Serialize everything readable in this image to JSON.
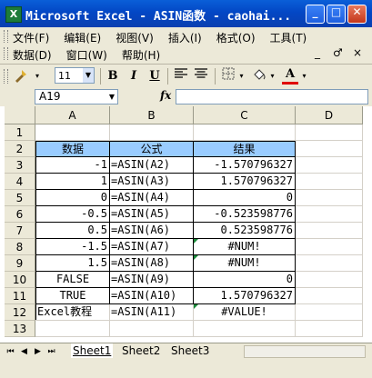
{
  "window": {
    "title": "Microsoft Excel - ASIN函数 - caohai...",
    "app_icon_letter": "X",
    "minimize_label": "_",
    "maximize_label": "□",
    "close_label": "✕"
  },
  "menu": {
    "row1": [
      "文件(F)",
      "编辑(E)",
      "视图(V)",
      "插入(I)",
      "格式(O)",
      "工具(T)"
    ],
    "row2": [
      "数据(D)",
      "窗口(W)",
      "帮助(H)"
    ],
    "doc_controls": [
      "_",
      "♂",
      "×"
    ]
  },
  "toolbar": {
    "font_size": "11",
    "bold": "B",
    "italic": "I",
    "underline": "U",
    "font_color_label": "A"
  },
  "formula_bar": {
    "name_box": "A19",
    "fx_label": "fx",
    "formula": ""
  },
  "grid": {
    "columns": [
      "A",
      "B",
      "C",
      "D"
    ],
    "rows": [
      "1",
      "2",
      "3",
      "4",
      "5",
      "6",
      "7",
      "8",
      "9",
      "10",
      "11",
      "12",
      "13"
    ],
    "header_row": {
      "A": "",
      "B": "",
      "C": "",
      "D": ""
    },
    "table": [
      {
        "row": 2,
        "a": "数据",
        "b": "公式",
        "c": "结果",
        "hdr": true
      },
      {
        "row": 3,
        "a": "-1",
        "b": "=ASIN(A2)",
        "c": "-1.570796327"
      },
      {
        "row": 4,
        "a": "1",
        "b": "=ASIN(A3)",
        "c": "1.570796327"
      },
      {
        "row": 5,
        "a": "0",
        "b": "=ASIN(A4)",
        "c": "0"
      },
      {
        "row": 6,
        "a": "-0.5",
        "b": "=ASIN(A5)",
        "c": "-0.523598776"
      },
      {
        "row": 7,
        "a": "0.5",
        "b": "=ASIN(A6)",
        "c": "0.523598776"
      },
      {
        "row": 8,
        "a": "-1.5",
        "b": "=ASIN(A7)",
        "c": "#NUM!"
      },
      {
        "row": 9,
        "a": "1.5",
        "b": "=ASIN(A8)",
        "c": "#NUM!"
      },
      {
        "row": 10,
        "a": "FALSE",
        "b": "=ASIN(A9)",
        "c": "0"
      },
      {
        "row": 11,
        "a": "TRUE",
        "b": "=ASIN(A10)",
        "c": "1.570796327"
      },
      {
        "row": 12,
        "a": "Excel教程",
        "b": "=ASIN(A11)",
        "c": "#VALUE!"
      }
    ],
    "header_fill": "#99ccff"
  },
  "sheets": {
    "tabs": [
      "Sheet1",
      "Sheet2",
      "Sheet3"
    ],
    "active": "Sheet1",
    "nav": [
      "⏮",
      "◀",
      "▶",
      "⏭"
    ]
  }
}
